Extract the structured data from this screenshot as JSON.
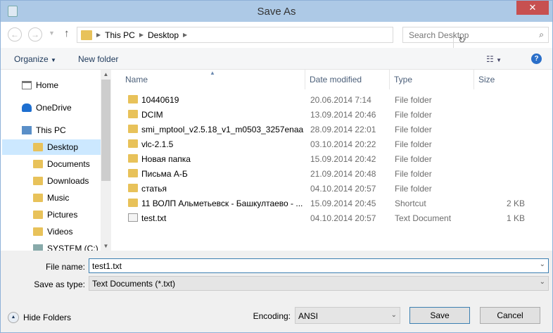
{
  "title": "Save As",
  "address": {
    "path": [
      "This PC",
      "Desktop"
    ],
    "search_placeholder": "Search Desktop"
  },
  "toolbar": {
    "organize": "Organize",
    "new_folder": "New folder"
  },
  "nav": [
    {
      "label": "Home"
    },
    {
      "label": "OneDrive"
    },
    {
      "label": "This PC"
    },
    {
      "label": "Desktop"
    },
    {
      "label": "Documents"
    },
    {
      "label": "Downloads"
    },
    {
      "label": "Music"
    },
    {
      "label": "Pictures"
    },
    {
      "label": "Videos"
    },
    {
      "label": "SYSTEM (C:)"
    }
  ],
  "columns": {
    "name": "Name",
    "date": "Date modified",
    "type": "Type",
    "size": "Size"
  },
  "files": [
    {
      "name": "10440619",
      "date": "20.06.2014 7:14",
      "type": "File folder",
      "size": "",
      "icon": "folder"
    },
    {
      "name": "DCIM",
      "date": "13.09.2014 20:46",
      "type": "File folder",
      "size": "",
      "icon": "folder"
    },
    {
      "name": "smi_mptool_v2.5.18_v1_m0503_3257enaa",
      "date": "28.09.2014 22:01",
      "type": "File folder",
      "size": "",
      "icon": "folder"
    },
    {
      "name": "vlc-2.1.5",
      "date": "03.10.2014 20:22",
      "type": "File folder",
      "size": "",
      "icon": "folder"
    },
    {
      "name": "Новая папка",
      "date": "15.09.2014 20:42",
      "type": "File folder",
      "size": "",
      "icon": "folder"
    },
    {
      "name": "Письма А-Б",
      "date": "21.09.2014 20:48",
      "type": "File folder",
      "size": "",
      "icon": "folder"
    },
    {
      "name": "статья",
      "date": "04.10.2014 20:57",
      "type": "File folder",
      "size": "",
      "icon": "folder"
    },
    {
      "name": "11 ВОЛП Альметьевск - Башкултаево - ...",
      "date": "15.09.2014 20:45",
      "type": "Shortcut",
      "size": "2 KB",
      "icon": "shortcut"
    },
    {
      "name": "test.txt",
      "date": "04.10.2014 20:57",
      "type": "Text Document",
      "size": "1 KB",
      "icon": "text"
    }
  ],
  "form": {
    "file_name_label": "File name:",
    "file_name": "test1.txt",
    "type_label": "Save as type:",
    "type_value": "Text Documents (*.txt)",
    "encoding_label": "Encoding:",
    "encoding": "ANSI",
    "hide_folders": "Hide Folders",
    "save": "Save",
    "cancel": "Cancel"
  }
}
